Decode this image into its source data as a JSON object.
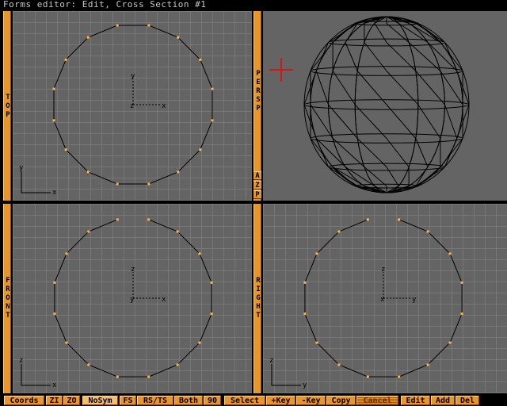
{
  "window": {
    "title": "Forms editor: Edit, Cross Section #1"
  },
  "viewports": {
    "top": {
      "label": "TOP",
      "h_axis": "x",
      "v_axis": "y",
      "corner_h": "x",
      "corner_v": "y",
      "center_h": "x",
      "center_v": "y",
      "center_mark": "z"
    },
    "persp": {
      "label": "PERSP",
      "btn_a": "A",
      "btn_z": "Z",
      "btn_p": "P"
    },
    "front": {
      "label": "FRONT",
      "corner_h": "x",
      "corner_v": "z",
      "center_h": "x",
      "center_v": "z",
      "center_mark": "y"
    },
    "right": {
      "label": "RIGHT",
      "corner_h": "y",
      "corner_v": "z",
      "center_h": "y",
      "center_v": "z",
      "center_mark": "x"
    }
  },
  "toolbar": {
    "coords": "Coords",
    "zi": "ZI",
    "zo": "ZO",
    "nosym": "NoSym",
    "fs": "FS",
    "rsts": "RS/TS",
    "both": "Both",
    "ninety": "90",
    "select": "Select",
    "addkey": "+Key",
    "delkey": "-Key",
    "copy": "Copy",
    "cancel": "Cancel",
    "edit": "Edit",
    "add": "Add",
    "del": "Del"
  },
  "colors": {
    "viewport_bg": "#646464",
    "grid": "#7d7d7d",
    "accent": "#e8962c",
    "point": "#ffb648",
    "cursor": "#d01818"
  }
}
